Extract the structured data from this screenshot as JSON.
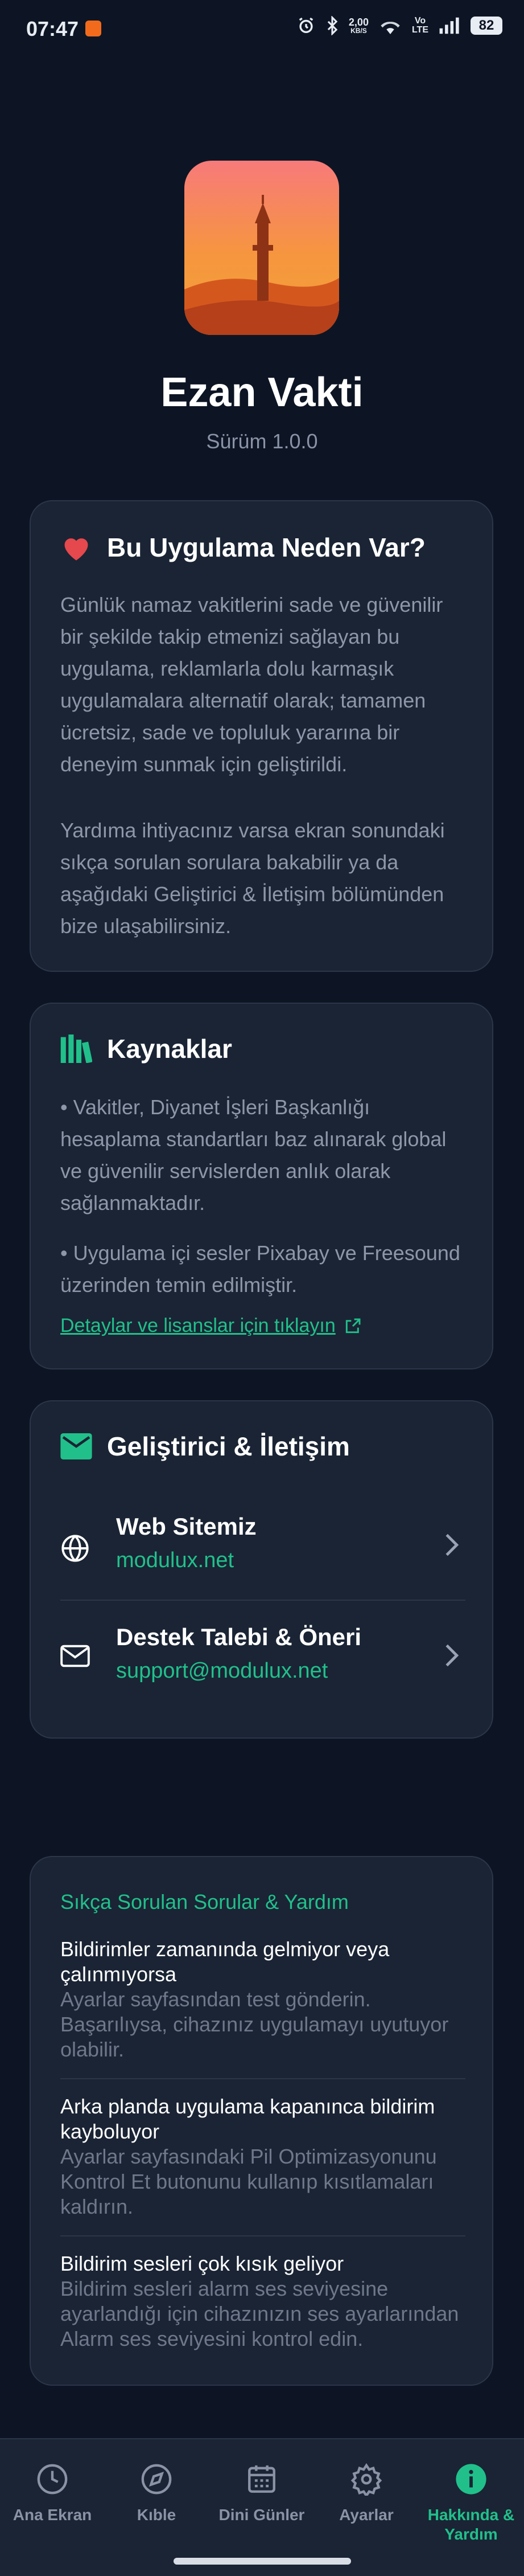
{
  "status_bar": {
    "time": "07:47",
    "speed_value": "2,00",
    "speed_unit": "KB/S",
    "volte_top": "Vo",
    "volte_bottom": "LTE",
    "battery": "82"
  },
  "app": {
    "title": "Ezan Vakti",
    "version": "Sürüm 1.0.0"
  },
  "about": {
    "title": "Bu Uygulama Neden Var?",
    "paragraph1": "Günlük namaz vakitlerini sade ve güvenilir bir şekilde takip etmenizi sağlayan bu uygulama, reklamlarla dolu karmaşık uygulamalara alternatif olarak; tamamen ücretsiz, sade ve topluluk yararına bir deneyim sunmak için geliştirildi.",
    "paragraph2": "Yardıma ihtiyacınız varsa ekran sonundaki sıkça sorulan sorulara bakabilir ya da aşağıdaki Geliştirici & İletişim bölümünden bize ulaşabilirsiniz."
  },
  "sources": {
    "title": "Kaynaklar",
    "item1": "• Vakitler, Diyanet İşleri Başkanlığı hesaplama standartları baz alınarak global ve güvenilir servislerden anlık olarak sağlanmaktadır.",
    "item2": "• Uygulama içi sesler Pixabay ve Freesound üzerinden temin edilmiştir.",
    "link": "Detaylar ve lisanslar için tıklayın"
  },
  "contact": {
    "title": "Geliştirici & İletişim",
    "web_title": "Web Sitemiz",
    "web_value": "modulux.net",
    "support_title": "Destek Talebi & Öneri",
    "support_value": "support@modulux.net"
  },
  "faq": {
    "title": "Sıkça Sorulan Sorular & Yardım",
    "items": [
      {
        "q": "Bildirimler zamanında gelmiyor veya çalınmıyorsa",
        "a": "Ayarlar sayfasından test gönderin. Başarılıysa, cihazınız uygulamayı uyutuyor olabilir."
      },
      {
        "q": "Arka planda uygulama kapanınca bildirim kayboluyor",
        "a": "Ayarlar sayfasındaki Pil Optimizasyonunu Kontrol Et butonunu kullanıp kısıtlamaları kaldırın."
      },
      {
        "q": "Bildirim sesleri çok kısık geliyor",
        "a": "Bildirim sesleri alarm ses seviyesine ayarlandığı için cihazınızın ses ayarlarından Alarm ses seviyesini kontrol edin."
      }
    ]
  },
  "nav": {
    "home": "Ana Ekran",
    "qibla": "Kıble",
    "religious_days": "Dini Günler",
    "settings": "Ayarlar",
    "about_line1": "Hakkında &",
    "about_line2": "Yardım"
  },
  "colors": {
    "accent": "#21c08b",
    "background": "#0d1524",
    "card": "#1a2434",
    "heart": "#e5484d"
  }
}
